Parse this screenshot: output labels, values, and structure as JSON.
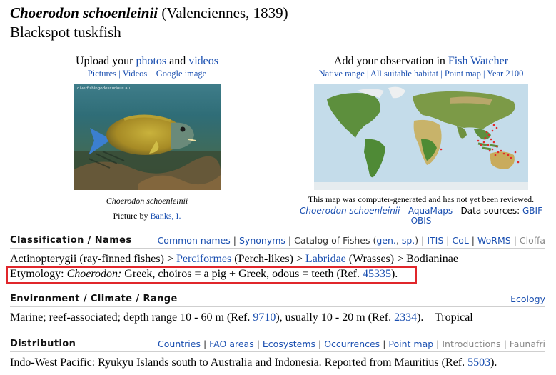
{
  "header": {
    "scientific_name": "Choerodon schoenleinii",
    "author": "(Valenciennes, 1839)",
    "common_name": "Blackspot tuskfish"
  },
  "photo": {
    "upload_prefix": "Upload your",
    "photos_link": "photos",
    "and": "and",
    "videos_link": "videos",
    "sub_pictures": "Pictures",
    "sub_sep": "|",
    "sub_videos": "Videos",
    "sub_google": "Google image",
    "watermark": "diverfishingodexcurious.au",
    "caption": "Choerodon schoenleinii",
    "credit_prefix": "Picture by",
    "credit_link": "Banks, I."
  },
  "map": {
    "add_prefix": "Add your observation in",
    "fish_watcher": "Fish Watcher",
    "links": [
      "Native range",
      "All suitable habitat",
      "Point map",
      "Year 2100"
    ],
    "note": "This map was computer-generated and has not yet been reviewed.",
    "source_species": "Choerodon schoenleinii",
    "source_aquamaps": "AquaMaps",
    "source_label": "Data sources:",
    "source_gbif": "GBIF",
    "source_obis": "OBIS"
  },
  "classification": {
    "heading": "Classification / Names",
    "links": {
      "common_names": "Common names",
      "synonyms": "Synonyms",
      "catalog": "Catalog of Fishes (",
      "gen": "gen.",
      "sp": "sp.",
      "close_paren": ")",
      "itis": "ITIS",
      "col": "CoL",
      "worms": "WoRMS",
      "cloffa": "Cloffa"
    },
    "lineage_start": "Actinopterygii (ray-finned fishes) > ",
    "perciformes": "Perciformes",
    "perch_likes": " (Perch-likes) > ",
    "labridae": "Labridae",
    "wrasses": " (Wrasses) > Bodianinae",
    "etym_label": "Etymology: ",
    "etym_genus": "Choerodon:",
    "etym_text": " Greek, choiros = a pig + Greek, odous = teeth (Ref. ",
    "etym_ref": "45335",
    "etym_close": ")."
  },
  "environment": {
    "heading": "Environment / Climate / Range",
    "ecology_link": "Ecology",
    "text_start": "Marine; reef-associated; depth range 10 - 60 m (Ref. ",
    "ref1": "9710",
    "text_mid": "), usually 10 - 20 m (Ref. ",
    "ref2": "2334",
    "text_end": ").    Tropical"
  },
  "distribution": {
    "heading": "Distribution",
    "links": {
      "countries": "Countries",
      "fao": "FAO areas",
      "ecosystems": "Ecosystems",
      "occurrences": "Occurrences",
      "pointmap": "Point map",
      "introductions": "Introductions",
      "faunafri": "Faunafri"
    },
    "text": "Indo-West Pacific: Ryukyu Islands south to Australia and Indonesia. Reported from Mauritius (Ref. ",
    "ref": "5503",
    "close": ")."
  },
  "colors": {
    "link": "#1a4fb0",
    "highlight_border": "#e0262b"
  }
}
